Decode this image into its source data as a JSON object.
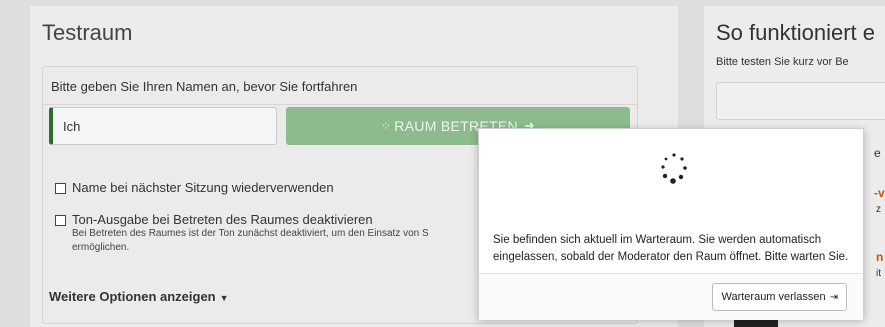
{
  "left": {
    "title": "Testraum",
    "prompt": "Bitte geben Sie Ihren Namen an, bevor Sie fortfahren",
    "name_input_value": "Ich",
    "enter_button_label": "RAUM BETRETEN",
    "checkbox_reuse_label": "Name bei nächster Sitzung wiederverwenden",
    "checkbox_mute_label": "Ton-Ausgabe bei Betreten des Raumes deaktivieren",
    "mute_hint": "Bei Betreten des Raumes ist der Ton zunächst deaktiviert, um den Einsatz von S",
    "mute_hint_line2": "ermöglichen.",
    "more_options_label": "Weitere Optionen anzeigen"
  },
  "right": {
    "title": "So funktioniert e",
    "subtitle": "Bitte testen Sie kurz vor Be",
    "frag_1": "e",
    "frag_2": "-v",
    "frag_3": "z",
    "frag_4": "n",
    "frag_5": "it"
  },
  "modal": {
    "message": "Sie befinden sich aktuell im Warteraum. Sie werden automatisch eingelassen, sobald der Moderator den Raum öffnet. Bitte warten Sie.",
    "leave_button_label": "Warteraum verlassen"
  },
  "icons": {
    "spinner": "spinner-icon",
    "enter": "sign-in-icon",
    "leave": "sign-out-icon",
    "caret": "caret-down-icon"
  },
  "colors": {
    "enter_button": "#8dbb8d",
    "input_accent": "#2e6b2e",
    "orange_text": "#cc5500"
  }
}
